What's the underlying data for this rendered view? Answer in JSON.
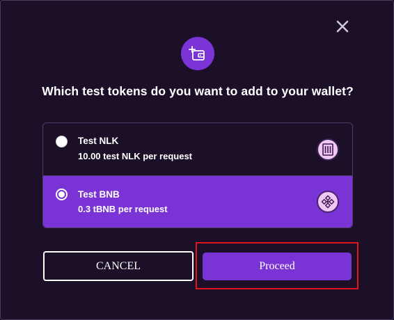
{
  "dialog": {
    "title": "Which test tokens do you want to add to your wallet?",
    "close_icon": "close-icon",
    "header_icon": "wallet-add-icon"
  },
  "options": [
    {
      "name": "Test NLK",
      "description": "10.00 test NLK per request",
      "selected": false,
      "icon": "nlk-token-icon"
    },
    {
      "name": "Test BNB",
      "description": "0.3 tBNB per request",
      "selected": true,
      "icon": "bnb-token-icon"
    }
  ],
  "buttons": {
    "cancel": "CANCEL",
    "proceed": "Proceed"
  },
  "colors": {
    "background": "#1b1028",
    "accent": "#7a34d6",
    "highlight": "#e0141e",
    "token_badge": "#f0c8f4"
  }
}
